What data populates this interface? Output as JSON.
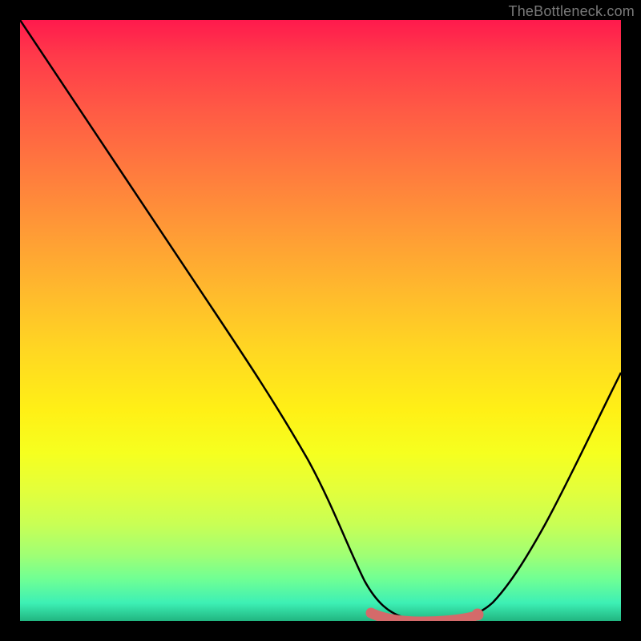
{
  "attribution": "TheBottleneck.com",
  "chart_data": {
    "type": "line",
    "title": "",
    "xlabel": "",
    "ylabel": "",
    "xlim": [
      0,
      100
    ],
    "ylim": [
      0,
      100
    ],
    "series": [
      {
        "name": "bottleneck-curve",
        "x": [
          0,
          5,
          10,
          15,
          20,
          25,
          30,
          35,
          40,
          45,
          50,
          55,
          58,
          60,
          63,
          66,
          70,
          73,
          76,
          80,
          84,
          88,
          92,
          96,
          100
        ],
        "values": [
          100,
          93,
          86,
          79,
          72,
          65,
          57,
          49,
          41,
          33,
          24,
          15,
          9,
          6,
          3,
          1,
          0,
          0,
          1,
          4,
          10,
          17,
          25,
          33,
          41
        ]
      }
    ],
    "marker_band": {
      "name": "optimal-range",
      "x_start": 58,
      "x_end": 76,
      "color": "#d46a6a"
    },
    "marker_dot": {
      "name": "optimal-end-dot",
      "x": 76,
      "y": 1,
      "color": "#d46a6a"
    },
    "gradient_stops": [
      {
        "pos": 0,
        "color": "#ff1a4d"
      },
      {
        "pos": 50,
        "color": "#ffd722"
      },
      {
        "pos": 100,
        "color": "#21b580"
      }
    ]
  }
}
